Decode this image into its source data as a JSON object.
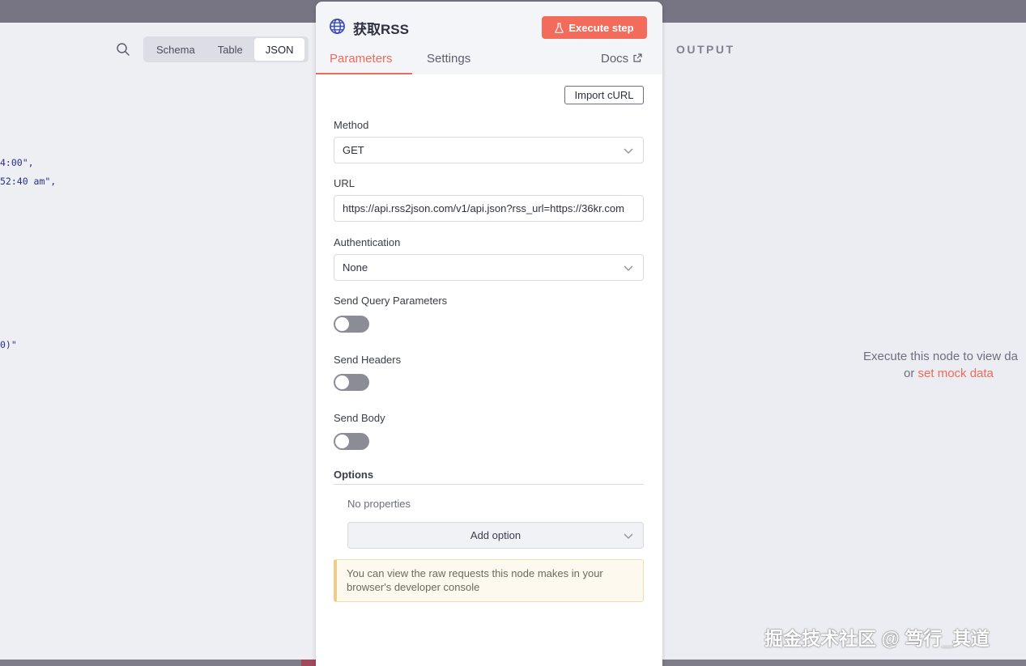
{
  "input_panel": {
    "views": [
      "Schema",
      "Table",
      "JSON"
    ],
    "active_view": "JSON",
    "json_fragments": [
      "4:00\",",
      "52:40 am\",",
      "0)\""
    ]
  },
  "node": {
    "title": "获取RSS",
    "execute_label": "Execute step",
    "tabs": {
      "parameters": "Parameters",
      "settings": "Settings",
      "docs": "Docs"
    },
    "import_curl_label": "Import cURL",
    "method": {
      "label": "Method",
      "value": "GET"
    },
    "url": {
      "label": "URL",
      "value": "https://api.rss2json.com/v1/api.json?rss_url=https://36kr.com"
    },
    "authentication": {
      "label": "Authentication",
      "value": "None"
    },
    "send_query": {
      "label": "Send Query Parameters",
      "enabled": false
    },
    "send_headers": {
      "label": "Send Headers",
      "enabled": false
    },
    "send_body": {
      "label": "Send Body",
      "enabled": false
    },
    "options": {
      "label": "Options",
      "empty_text": "No properties",
      "add_label": "Add option"
    },
    "notice": "You can view the raw requests this node makes in your browser's developer console"
  },
  "output_panel": {
    "title": "OUTPUT",
    "empty_line1": "Execute this node to view da",
    "empty_or": "or ",
    "mock_link": "set mock data"
  },
  "watermark": "掘金技术社区 @ 笃行_其道",
  "colors": {
    "accent": "#f26b5b",
    "toggle_off": "#8b8c96",
    "json_text": "#2a2f8c"
  }
}
